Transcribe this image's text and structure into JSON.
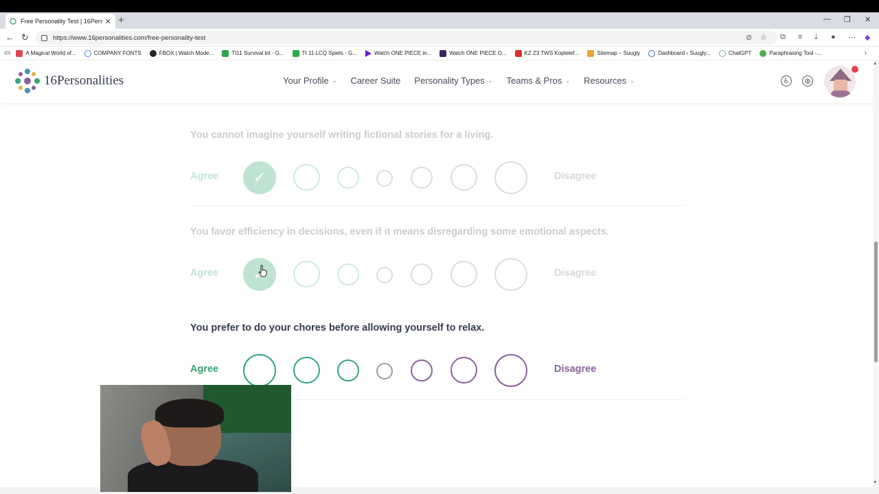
{
  "browser": {
    "tab_title": "Free Personality Test | 16Personali",
    "url": "https://www.16personalities.com/free-personality-test",
    "bookmarks": [
      {
        "label": "A Magical World of...",
        "color": "#e0464e"
      },
      {
        "label": "COMPANY FONTS",
        "color": "#ffffff"
      },
      {
        "label": "FBOX | Watch Mode...",
        "color": "#222222"
      },
      {
        "label": "TI11 Survival kit - G...",
        "color": "#2ea84a"
      },
      {
        "label": "TI 11 LCQ Spiels - G...",
        "color": "#2ea84a"
      },
      {
        "label": "Watch ONE PIECE in...",
        "color": "#6a1bd1"
      },
      {
        "label": "Watch ONE PIECE O...",
        "color": "#3a2460"
      },
      {
        "label": "KZ Z3 TWS Koptelef...",
        "color": "#d8302c"
      },
      {
        "label": "Sitemap – Suugly",
        "color": "#e8a531"
      },
      {
        "label": "Dashboard ‹ Suugly...",
        "color": "#3b6ea8"
      },
      {
        "label": "ChatGPT",
        "color": "#74aa9c"
      },
      {
        "label": "Paraphrasing Tool -...",
        "color": "#4caf50"
      }
    ]
  },
  "site": {
    "logo_text": "16Personalities",
    "nav": [
      {
        "label": "Your Profile",
        "dropdown": true
      },
      {
        "label": "Career Suite",
        "dropdown": false
      },
      {
        "label": "Personality Types",
        "dropdown": true
      },
      {
        "label": "Teams & Pros",
        "dropdown": true
      },
      {
        "label": "Resources",
        "dropdown": true
      }
    ]
  },
  "questions": [
    {
      "text": "You cannot imagine yourself writing fictional stories for a living.",
      "agree": "Agree",
      "disagree": "Disagree",
      "state": "answered",
      "selected_index": 0
    },
    {
      "text": "You favor efficiency in decisions, even if it means disregarding some emotional aspects.",
      "agree": "Agree",
      "disagree": "Disagree",
      "state": "answered",
      "selected_index": 0
    },
    {
      "text": "You prefer to do your chores before allowing yourself to relax.",
      "agree": "Agree",
      "disagree": "Disagree",
      "state": "active",
      "selected_index": null
    }
  ],
  "colors": {
    "agree": "#33a474",
    "disagree": "#88619a",
    "text": "#343c4b"
  }
}
